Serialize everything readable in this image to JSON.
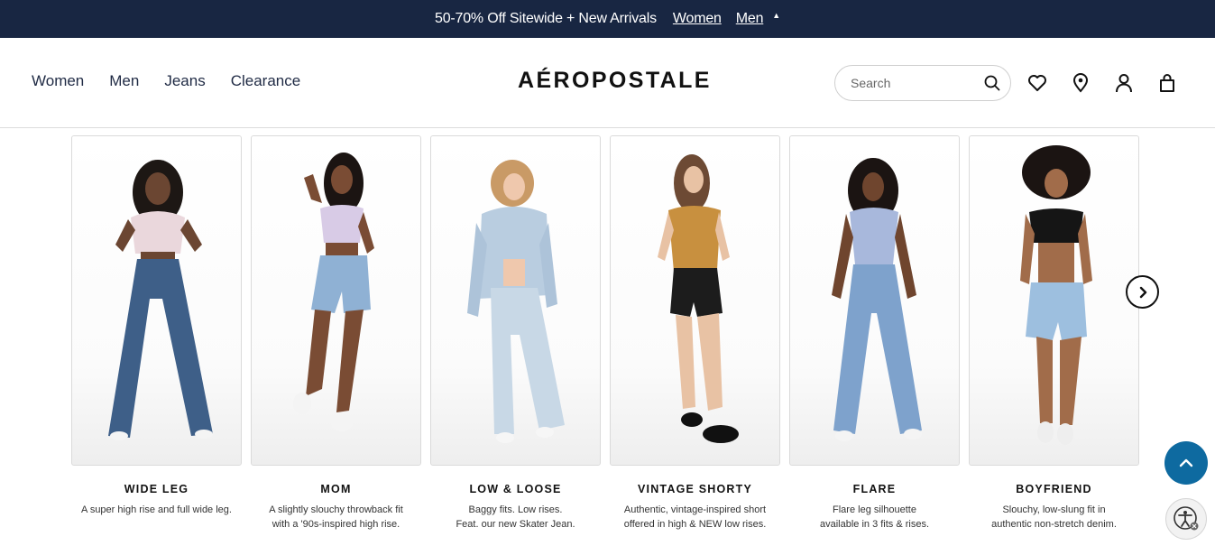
{
  "promo": {
    "text": "50-70% Off Sitewide + New Arrivals",
    "link_women": "Women",
    "link_men": "Men",
    "caret": "▲"
  },
  "nav": {
    "items": [
      "Women",
      "Men",
      "Jeans",
      "Clearance"
    ]
  },
  "brand": {
    "logo_text": "AÉROPOSTALE"
  },
  "search": {
    "placeholder": "Search"
  },
  "header_icons": [
    "heart-icon",
    "location-icon",
    "account-icon",
    "bag-icon"
  ],
  "colors": {
    "promo_bg": "#182642",
    "nav_text": "#1f2a44",
    "back_to_top": "#0e6aa0"
  },
  "products": [
    {
      "title": "WIDE LEG",
      "desc_line1": "A super high rise and full wide leg.",
      "desc_line2": ""
    },
    {
      "title": "MOM",
      "desc_line1": "A slightly slouchy throwback fit",
      "desc_line2": "with a '90s-inspired high rise."
    },
    {
      "title": "LOW & LOOSE",
      "desc_line1": "Baggy fits. Low rises.",
      "desc_line2": "Feat. our new Skater Jean."
    },
    {
      "title": "VINTAGE SHORTY",
      "desc_line1": "Authentic, vintage-inspired short",
      "desc_line2": "offered in high & NEW low rises."
    },
    {
      "title": "FLARE",
      "desc_line1": "Flare leg silhouette",
      "desc_line2": "available in 3 fits & rises."
    },
    {
      "title": "BOYFRIEND",
      "desc_line1": "Slouchy, low-slung fit in",
      "desc_line2": "authentic non-stretch denim."
    }
  ]
}
